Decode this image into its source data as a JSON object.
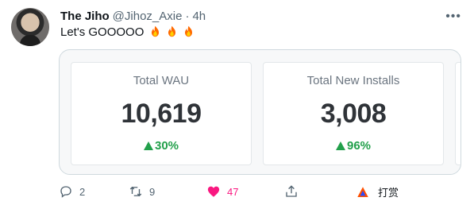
{
  "tweet": {
    "author_name": "The Jiho",
    "author_handle": "@Jihoz_Axie",
    "separator": "·",
    "time": "4h",
    "text": "Let's GOOOOO",
    "fire_emojis": [
      "fire",
      "fire",
      "fire"
    ]
  },
  "card": {
    "stats": [
      {
        "label": "Total WAU",
        "value": "10,619",
        "change": "30%"
      },
      {
        "label": "Total New Installs",
        "value": "3,008",
        "change": "96%"
      }
    ]
  },
  "actions": {
    "reply_count": "2",
    "retweet_count": "9",
    "like_count": "47",
    "brand_label": "打赏"
  },
  "colors": {
    "like": "#f91880",
    "positive": "#22a04b",
    "secondary_text": "#536471"
  },
  "icons": {
    "reply": "reply-icon",
    "retweet": "retweet-icon",
    "like": "heart-icon",
    "share": "share-icon",
    "brand": "tip-logo-icon",
    "more": "more-icon"
  }
}
